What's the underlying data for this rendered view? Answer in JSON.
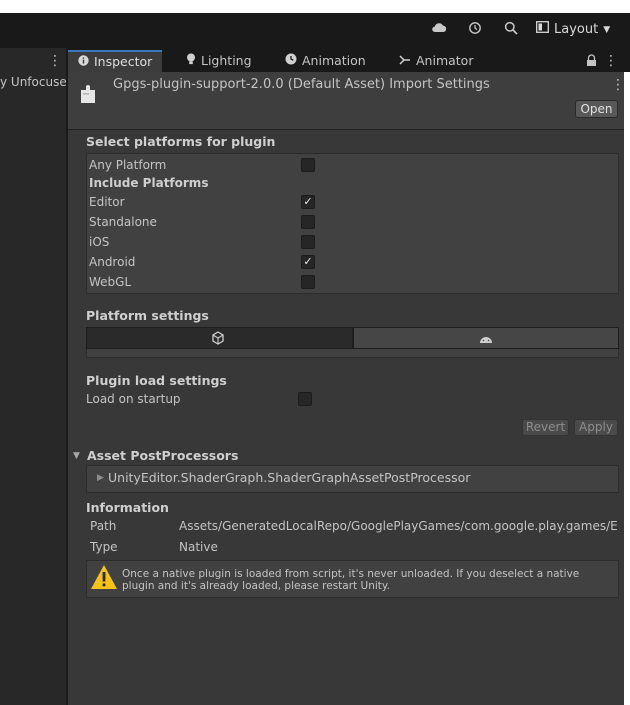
{
  "toolbar": {
    "layout_label": "Layout",
    "icons": [
      "cloud-icon",
      "history-icon",
      "search-icon",
      "layout-icon",
      "chevron-down-icon"
    ]
  },
  "left_panel": {
    "header_text": "y Unfocused"
  },
  "tabs": [
    {
      "label": "Inspector",
      "icon": "info-icon",
      "active": true
    },
    {
      "label": "Lighting",
      "icon": "bulb-icon",
      "active": false
    },
    {
      "label": "Animation",
      "icon": "clock-icon",
      "active": false
    },
    {
      "label": "Animator",
      "icon": "animator-icon",
      "active": false
    }
  ],
  "header": {
    "title": "Gpgs-plugin-support-2.0.0 (Default Asset) Import Settings",
    "open_label": "Open"
  },
  "platforms": {
    "section_title": "Select platforms for plugin",
    "any_platform_label": "Any Platform",
    "include_label": "Include Platforms",
    "items": [
      {
        "label": "Editor",
        "checked": true
      },
      {
        "label": "Standalone",
        "checked": false
      },
      {
        "label": "iOS",
        "checked": false
      },
      {
        "label": "Android",
        "checked": true
      },
      {
        "label": "WebGL",
        "checked": false
      }
    ]
  },
  "platform_settings": {
    "title": "Platform settings"
  },
  "plugin_load": {
    "title": "Plugin load settings",
    "load_on_startup_label": "Load on startup"
  },
  "actions": {
    "revert_label": "Revert",
    "apply_label": "Apply"
  },
  "postprocessors": {
    "title": "Asset PostProcessors",
    "item": "UnityEditor.ShaderGraph.ShaderGraphAssetPostProcessor"
  },
  "information": {
    "title": "Information",
    "path_label": "Path",
    "path_value": "Assets/GeneratedLocalRepo/GooglePlayGames/com.google.play.games/Edito",
    "type_label": "Type",
    "type_value": "Native"
  },
  "warning": {
    "text": "Once a native plugin is loaded from script, it's never unloaded. If you deselect a native plugin and it's already loaded, please restart Unity."
  }
}
